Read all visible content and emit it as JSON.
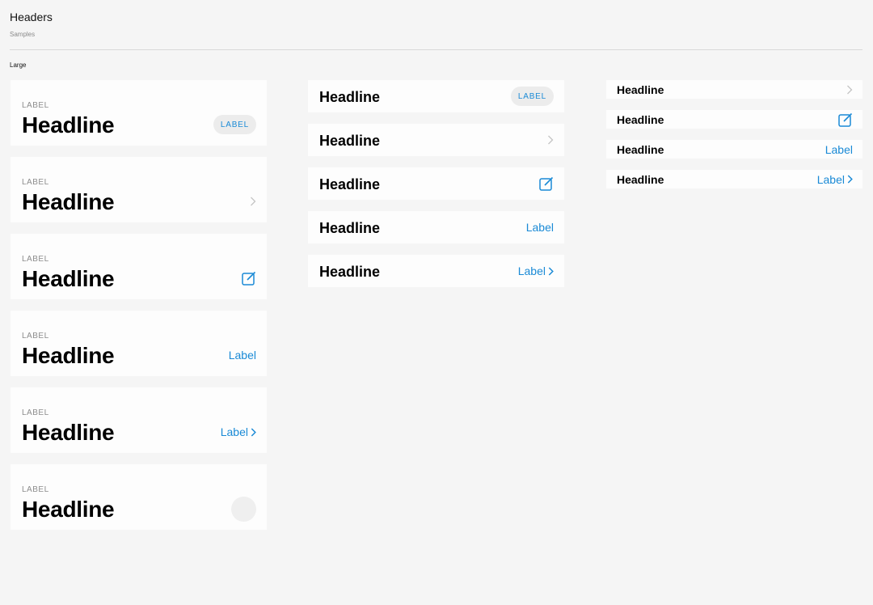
{
  "header": {
    "title": "Headers",
    "subtitle": "Samples"
  },
  "section": {
    "label": "Large"
  },
  "colors": {
    "accent": "#1a8ad6",
    "muted": "#8c8c8c",
    "card": "#fdfdfd",
    "background": "#f5f5f5"
  },
  "large": [
    {
      "eyebrow": "LABEL",
      "headline": "Headline",
      "accessory": "pill",
      "accessory_label": "LABEL"
    },
    {
      "eyebrow": "LABEL",
      "headline": "Headline",
      "accessory": "chevron-right-icon"
    },
    {
      "eyebrow": "LABEL",
      "headline": "Headline",
      "accessory": "compose-icon"
    },
    {
      "eyebrow": "LABEL",
      "headline": "Headline",
      "accessory": "link",
      "accessory_label": "Label"
    },
    {
      "eyebrow": "LABEL",
      "headline": "Headline",
      "accessory": "link-chevron",
      "accessory_label": "Label"
    },
    {
      "eyebrow": "LABEL",
      "headline": "Headline",
      "accessory": "avatar-placeholder"
    }
  ],
  "medium": [
    {
      "headline": "Headline",
      "accessory": "pill",
      "accessory_label": "LABEL"
    },
    {
      "headline": "Headline",
      "accessory": "chevron-right-icon"
    },
    {
      "headline": "Headline",
      "accessory": "compose-icon"
    },
    {
      "headline": "Headline",
      "accessory": "link",
      "accessory_label": "Label"
    },
    {
      "headline": "Headline",
      "accessory": "link-chevron",
      "accessory_label": "Label"
    }
  ],
  "small": [
    {
      "headline": "Headline",
      "accessory": "chevron-right-icon"
    },
    {
      "headline": "Headline",
      "accessory": "compose-icon"
    },
    {
      "headline": "Headline",
      "accessory": "link",
      "accessory_label": "Label"
    },
    {
      "headline": "Headline",
      "accessory": "link-chevron",
      "accessory_label": "Label"
    }
  ]
}
